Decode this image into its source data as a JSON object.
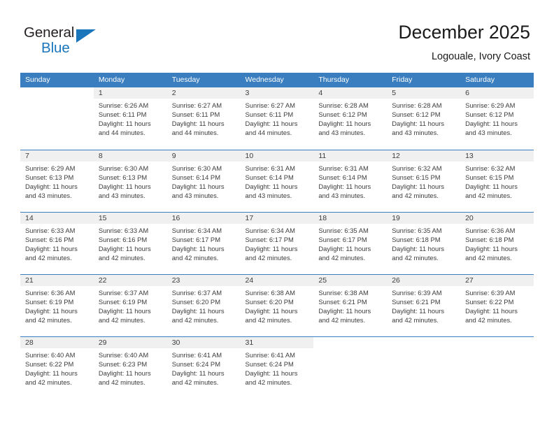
{
  "brand": {
    "name_part1": "General",
    "name_part2": "Blue",
    "triangle_icon": "triangle-icon",
    "accent_color": "#1b75bb"
  },
  "header": {
    "title": "December 2025",
    "subtitle": "Logouale, Ivory Coast"
  },
  "theme": {
    "header_row_color": "#3a7ebf",
    "daynum_band_color": "#f0f0f0",
    "text_color": "#3c3c3c"
  },
  "weekday_headers": [
    "Sunday",
    "Monday",
    "Tuesday",
    "Wednesday",
    "Thursday",
    "Friday",
    "Saturday"
  ],
  "weeks": [
    [
      {
        "day": "",
        "blank": true,
        "sunrise": "",
        "sunset": "",
        "daylight1": "",
        "daylight2": ""
      },
      {
        "day": "1",
        "sunrise": "Sunrise: 6:26 AM",
        "sunset": "Sunset: 6:11 PM",
        "daylight1": "Daylight: 11 hours",
        "daylight2": "and 44 minutes."
      },
      {
        "day": "2",
        "sunrise": "Sunrise: 6:27 AM",
        "sunset": "Sunset: 6:11 PM",
        "daylight1": "Daylight: 11 hours",
        "daylight2": "and 44 minutes."
      },
      {
        "day": "3",
        "sunrise": "Sunrise: 6:27 AM",
        "sunset": "Sunset: 6:11 PM",
        "daylight1": "Daylight: 11 hours",
        "daylight2": "and 44 minutes."
      },
      {
        "day": "4",
        "sunrise": "Sunrise: 6:28 AM",
        "sunset": "Sunset: 6:12 PM",
        "daylight1": "Daylight: 11 hours",
        "daylight2": "and 43 minutes."
      },
      {
        "day": "5",
        "sunrise": "Sunrise: 6:28 AM",
        "sunset": "Sunset: 6:12 PM",
        "daylight1": "Daylight: 11 hours",
        "daylight2": "and 43 minutes."
      },
      {
        "day": "6",
        "sunrise": "Sunrise: 6:29 AM",
        "sunset": "Sunset: 6:12 PM",
        "daylight1": "Daylight: 11 hours",
        "daylight2": "and 43 minutes."
      }
    ],
    [
      {
        "day": "7",
        "sunrise": "Sunrise: 6:29 AM",
        "sunset": "Sunset: 6:13 PM",
        "daylight1": "Daylight: 11 hours",
        "daylight2": "and 43 minutes."
      },
      {
        "day": "8",
        "sunrise": "Sunrise: 6:30 AM",
        "sunset": "Sunset: 6:13 PM",
        "daylight1": "Daylight: 11 hours",
        "daylight2": "and 43 minutes."
      },
      {
        "day": "9",
        "sunrise": "Sunrise: 6:30 AM",
        "sunset": "Sunset: 6:14 PM",
        "daylight1": "Daylight: 11 hours",
        "daylight2": "and 43 minutes."
      },
      {
        "day": "10",
        "sunrise": "Sunrise: 6:31 AM",
        "sunset": "Sunset: 6:14 PM",
        "daylight1": "Daylight: 11 hours",
        "daylight2": "and 43 minutes."
      },
      {
        "day": "11",
        "sunrise": "Sunrise: 6:31 AM",
        "sunset": "Sunset: 6:14 PM",
        "daylight1": "Daylight: 11 hours",
        "daylight2": "and 43 minutes."
      },
      {
        "day": "12",
        "sunrise": "Sunrise: 6:32 AM",
        "sunset": "Sunset: 6:15 PM",
        "daylight1": "Daylight: 11 hours",
        "daylight2": "and 42 minutes."
      },
      {
        "day": "13",
        "sunrise": "Sunrise: 6:32 AM",
        "sunset": "Sunset: 6:15 PM",
        "daylight1": "Daylight: 11 hours",
        "daylight2": "and 42 minutes."
      }
    ],
    [
      {
        "day": "14",
        "sunrise": "Sunrise: 6:33 AM",
        "sunset": "Sunset: 6:16 PM",
        "daylight1": "Daylight: 11 hours",
        "daylight2": "and 42 minutes."
      },
      {
        "day": "15",
        "sunrise": "Sunrise: 6:33 AM",
        "sunset": "Sunset: 6:16 PM",
        "daylight1": "Daylight: 11 hours",
        "daylight2": "and 42 minutes."
      },
      {
        "day": "16",
        "sunrise": "Sunrise: 6:34 AM",
        "sunset": "Sunset: 6:17 PM",
        "daylight1": "Daylight: 11 hours",
        "daylight2": "and 42 minutes."
      },
      {
        "day": "17",
        "sunrise": "Sunrise: 6:34 AM",
        "sunset": "Sunset: 6:17 PM",
        "daylight1": "Daylight: 11 hours",
        "daylight2": "and 42 minutes."
      },
      {
        "day": "18",
        "sunrise": "Sunrise: 6:35 AM",
        "sunset": "Sunset: 6:17 PM",
        "daylight1": "Daylight: 11 hours",
        "daylight2": "and 42 minutes."
      },
      {
        "day": "19",
        "sunrise": "Sunrise: 6:35 AM",
        "sunset": "Sunset: 6:18 PM",
        "daylight1": "Daylight: 11 hours",
        "daylight2": "and 42 minutes."
      },
      {
        "day": "20",
        "sunrise": "Sunrise: 6:36 AM",
        "sunset": "Sunset: 6:18 PM",
        "daylight1": "Daylight: 11 hours",
        "daylight2": "and 42 minutes."
      }
    ],
    [
      {
        "day": "21",
        "sunrise": "Sunrise: 6:36 AM",
        "sunset": "Sunset: 6:19 PM",
        "daylight1": "Daylight: 11 hours",
        "daylight2": "and 42 minutes."
      },
      {
        "day": "22",
        "sunrise": "Sunrise: 6:37 AM",
        "sunset": "Sunset: 6:19 PM",
        "daylight1": "Daylight: 11 hours",
        "daylight2": "and 42 minutes."
      },
      {
        "day": "23",
        "sunrise": "Sunrise: 6:37 AM",
        "sunset": "Sunset: 6:20 PM",
        "daylight1": "Daylight: 11 hours",
        "daylight2": "and 42 minutes."
      },
      {
        "day": "24",
        "sunrise": "Sunrise: 6:38 AM",
        "sunset": "Sunset: 6:20 PM",
        "daylight1": "Daylight: 11 hours",
        "daylight2": "and 42 minutes."
      },
      {
        "day": "25",
        "sunrise": "Sunrise: 6:38 AM",
        "sunset": "Sunset: 6:21 PM",
        "daylight1": "Daylight: 11 hours",
        "daylight2": "and 42 minutes."
      },
      {
        "day": "26",
        "sunrise": "Sunrise: 6:39 AM",
        "sunset": "Sunset: 6:21 PM",
        "daylight1": "Daylight: 11 hours",
        "daylight2": "and 42 minutes."
      },
      {
        "day": "27",
        "sunrise": "Sunrise: 6:39 AM",
        "sunset": "Sunset: 6:22 PM",
        "daylight1": "Daylight: 11 hours",
        "daylight2": "and 42 minutes."
      }
    ],
    [
      {
        "day": "28",
        "sunrise": "Sunrise: 6:40 AM",
        "sunset": "Sunset: 6:22 PM",
        "daylight1": "Daylight: 11 hours",
        "daylight2": "and 42 minutes."
      },
      {
        "day": "29",
        "sunrise": "Sunrise: 6:40 AM",
        "sunset": "Sunset: 6:23 PM",
        "daylight1": "Daylight: 11 hours",
        "daylight2": "and 42 minutes."
      },
      {
        "day": "30",
        "sunrise": "Sunrise: 6:41 AM",
        "sunset": "Sunset: 6:24 PM",
        "daylight1": "Daylight: 11 hours",
        "daylight2": "and 42 minutes."
      },
      {
        "day": "31",
        "sunrise": "Sunrise: 6:41 AM",
        "sunset": "Sunset: 6:24 PM",
        "daylight1": "Daylight: 11 hours",
        "daylight2": "and 42 minutes."
      },
      {
        "day": "",
        "blank": true,
        "sunrise": "",
        "sunset": "",
        "daylight1": "",
        "daylight2": ""
      },
      {
        "day": "",
        "blank": true,
        "sunrise": "",
        "sunset": "",
        "daylight1": "",
        "daylight2": ""
      },
      {
        "day": "",
        "blank": true,
        "sunrise": "",
        "sunset": "",
        "daylight1": "",
        "daylight2": ""
      }
    ]
  ]
}
